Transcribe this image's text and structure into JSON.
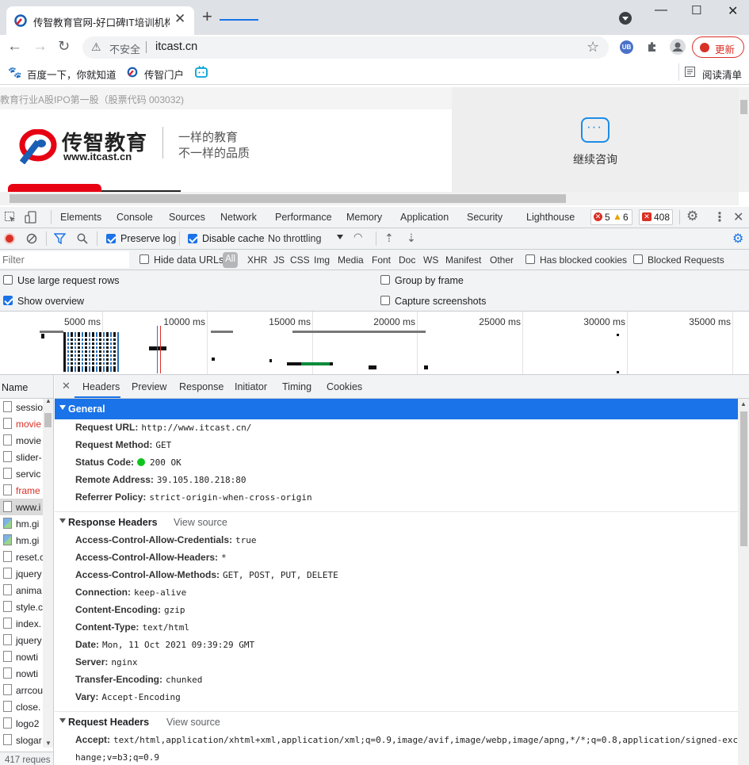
{
  "browser": {
    "tab_title": "传智教育官网-好口碑IT培训机构",
    "tab_close": "✕",
    "new_tab": "+",
    "window_controls": [
      "—",
      "☐",
      "✕"
    ],
    "not_secure": "不安全",
    "url": "itcast.cn",
    "update_label": "更新",
    "reading_list": "阅读清单",
    "bookmarks": [
      "百度一下，你就知道",
      "传智门户"
    ]
  },
  "page": {
    "banner": "教育行业A股IPO第一股（股票代码 003032)",
    "logo_name": "传智教育",
    "logo_url": "www.itcast.cn",
    "slogan_1": "一样的教育",
    "slogan_2": "不一样的品质",
    "consult": "继续咨询"
  },
  "devtools": {
    "tabs": [
      "Elements",
      "Console",
      "Sources",
      "Network",
      "Performance",
      "Memory",
      "Application",
      "Security",
      "Lighthouse"
    ],
    "active_tab": "Network",
    "error_count": "5",
    "warning_count": "6",
    "issue_count": "408",
    "preserve_log": "Preserve log",
    "disable_cache": "Disable cache",
    "throttling": "No throttling",
    "filter_placeholder": "Filter",
    "hide_data_urls": "Hide data URLs",
    "types": [
      "All",
      "XHR",
      "JS",
      "CSS",
      "Img",
      "Media",
      "Font",
      "Doc",
      "WS",
      "Manifest",
      "Other"
    ],
    "has_blocked_cookies": "Has blocked cookies",
    "blocked_requests": "Blocked Requests",
    "use_large_rows": "Use large request rows",
    "show_overview": "Show overview",
    "group_by_frame": "Group by frame",
    "capture_screenshots": "Capture screenshots",
    "timeline_ticks": [
      "5000 ms",
      "10000 ms",
      "15000 ms",
      "20000 ms",
      "25000 ms",
      "30000 ms",
      "35000 ms"
    ],
    "name_header": "Name",
    "requests": [
      {
        "name": "sessio",
        "red": false
      },
      {
        "name": "movie",
        "red": true
      },
      {
        "name": "movie",
        "red": false
      },
      {
        "name": "slider-",
        "red": false
      },
      {
        "name": "servic",
        "red": false
      },
      {
        "name": "frame",
        "red": true
      },
      {
        "name": "www.i",
        "red": false
      },
      {
        "name": "hm.gi",
        "red": false
      },
      {
        "name": "hm.gi",
        "red": false
      },
      {
        "name": "reset.c",
        "red": false
      },
      {
        "name": "jquery",
        "red": false
      },
      {
        "name": "anima",
        "red": false
      },
      {
        "name": "style.c",
        "red": false
      },
      {
        "name": "index.",
        "red": false
      },
      {
        "name": "jquery",
        "red": false
      },
      {
        "name": "nowti",
        "red": false
      },
      {
        "name": "nowti",
        "red": false
      },
      {
        "name": "arrcou",
        "red": false
      },
      {
        "name": "close.",
        "red": false
      },
      {
        "name": "logo2",
        "red": false
      },
      {
        "name": "slogar",
        "red": false
      }
    ],
    "request_count": "417 reques",
    "detail_tabs": [
      "Headers",
      "Preview",
      "Response",
      "Initiator",
      "Timing",
      "Cookies"
    ],
    "general_title": "General",
    "general": [
      {
        "k": "Request URL:",
        "v": "http://www.itcast.cn/"
      },
      {
        "k": "Request Method:",
        "v": "GET"
      },
      {
        "k": "Status Code:",
        "v": "200 OK"
      },
      {
        "k": "Remote Address:",
        "v": "39.105.180.218:80"
      },
      {
        "k": "Referrer Policy:",
        "v": "strict-origin-when-cross-origin"
      }
    ],
    "response_title": "Response Headers",
    "view_source": "View source",
    "response": [
      {
        "k": "Access-Control-Allow-Credentials:",
        "v": "true"
      },
      {
        "k": "Access-Control-Allow-Headers:",
        "v": "*"
      },
      {
        "k": "Access-Control-Allow-Methods:",
        "v": "GET, POST, PUT, DELETE"
      },
      {
        "k": "Connection:",
        "v": "keep-alive"
      },
      {
        "k": "Content-Encoding:",
        "v": "gzip"
      },
      {
        "k": "Content-Type:",
        "v": "text/html"
      },
      {
        "k": "Date:",
        "v": "Mon, 11 Oct 2021 09:39:29 GMT"
      },
      {
        "k": "Server:",
        "v": "nginx"
      },
      {
        "k": "Transfer-Encoding:",
        "v": "chunked"
      },
      {
        "k": "Vary:",
        "v": "Accept-Encoding"
      }
    ],
    "request_title": "Request Headers",
    "accept_key": "Accept:",
    "accept_value": "text/html,application/xhtml+xml,application/xml;q=0.9,image/avif,image/webp,image/apng,*/*;q=0.8,application/signed-exc",
    "accept_value_cont": "hange;v=b3;q=0.9"
  }
}
